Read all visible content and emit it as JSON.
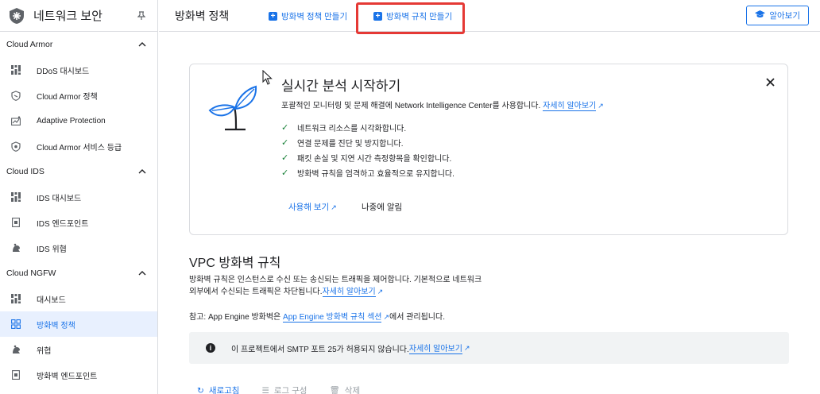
{
  "sidebar": {
    "title": "네트워크 보안",
    "sections": [
      {
        "label": "Cloud Armor",
        "items": [
          {
            "label": "DDoS 대시보드",
            "icon": "dashboard-icon"
          },
          {
            "label": "Cloud Armor 정책",
            "icon": "shield-icon"
          },
          {
            "label": "Adaptive Protection",
            "icon": "adaptive-icon"
          },
          {
            "label": "Cloud Armor 서비스 등급",
            "icon": "tier-icon"
          }
        ]
      },
      {
        "label": "Cloud IDS",
        "items": [
          {
            "label": "IDS 대시보드",
            "icon": "dashboard-icon"
          },
          {
            "label": "IDS 엔드포인트",
            "icon": "endpoint-icon"
          },
          {
            "label": "IDS 위협",
            "icon": "threat-icon"
          }
        ]
      },
      {
        "label": "Cloud NGFW",
        "items": [
          {
            "label": "대시보드",
            "icon": "dashboard-icon"
          },
          {
            "label": "방화벽 정책",
            "icon": "firewall-icon",
            "active": true
          },
          {
            "label": "위협",
            "icon": "threat-icon"
          },
          {
            "label": "방화벽 엔드포인트",
            "icon": "endpoint-icon"
          }
        ]
      }
    ]
  },
  "header": {
    "title": "방화벽 정책",
    "create_policy": "방화벽 정책 만들기",
    "create_rule": "방화벽 규칙 만들기",
    "learn": "알아보기"
  },
  "card": {
    "title": "실시간 분석 시작하기",
    "desc": "포괄적인 모니터링 및 문제 해결에 Network Intelligence Center를 사용합니다.",
    "desc_link": "자세히 알아보기",
    "checks": [
      "네트워크 리소스를 시각화합니다.",
      "연결 문제를 진단 및 방지합니다.",
      "패킷 손실 및 지연 시간 측정항목을 확인합니다.",
      "방화벽 규칙을 엄격하고 효율적으로 유지합니다."
    ],
    "try_label": "사용해 보기",
    "later_label": "나중에 알림"
  },
  "vpc": {
    "title": "VPC 방화벽 규칙",
    "desc_line1": "방화벽 규칙은 인스턴스로 수신 또는 송신되는 트래픽을 제어합니다. 기본적으로 네트워크",
    "desc_line2": "외부에서 수신되는 트래픽은 차단됩니다.",
    "desc_link": "자세히 알아보기",
    "note_prefix": "참고: App Engine 방화벽은 ",
    "note_link": "App Engine 방화벽 규칙 섹션",
    "note_suffix": "에서 관리됩니다.",
    "smtp_text": "이 프로젝트에서 SMTP 포트 25가 허용되지 않습니다.",
    "smtp_link": "자세히 알아보기"
  },
  "toolbar": {
    "refresh": "새로고침",
    "logs": "로그 구성",
    "delete": "삭제"
  },
  "colors": {
    "accent": "#1a73e8",
    "highlight": "#e53935",
    "check": "#188038"
  }
}
